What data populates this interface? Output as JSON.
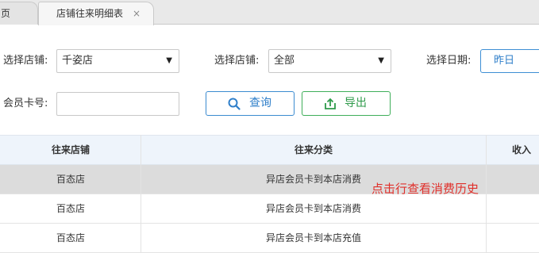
{
  "tabs": [
    {
      "label": "页"
    },
    {
      "label": "店铺往来明细表",
      "close": "×"
    }
  ],
  "filters": {
    "store_label": "选择店铺:",
    "store_value": "千姿店",
    "store2_label": "选择店铺:",
    "store2_value": "全部",
    "date_label": "选择日期:",
    "date_value": "昨日",
    "card_label": "会员卡号:",
    "card_value": ""
  },
  "actions": {
    "query_label": "查询",
    "export_label": "导出"
  },
  "table": {
    "columns": [
      "往来店铺",
      "往来分类",
      "收入"
    ],
    "rows": [
      {
        "store": "百态店",
        "category": "异店会员卡到本店消费"
      },
      {
        "store": "百态店",
        "category": "异店会员卡到本店消费"
      },
      {
        "store": "百态店",
        "category": "异店会员卡到本店充值"
      }
    ]
  },
  "annotation": "点击行查看消费历史",
  "colors": {
    "accent_blue": "#2f7fca",
    "accent_green": "#2e9a4a",
    "annotation_red": "#e0302b"
  }
}
